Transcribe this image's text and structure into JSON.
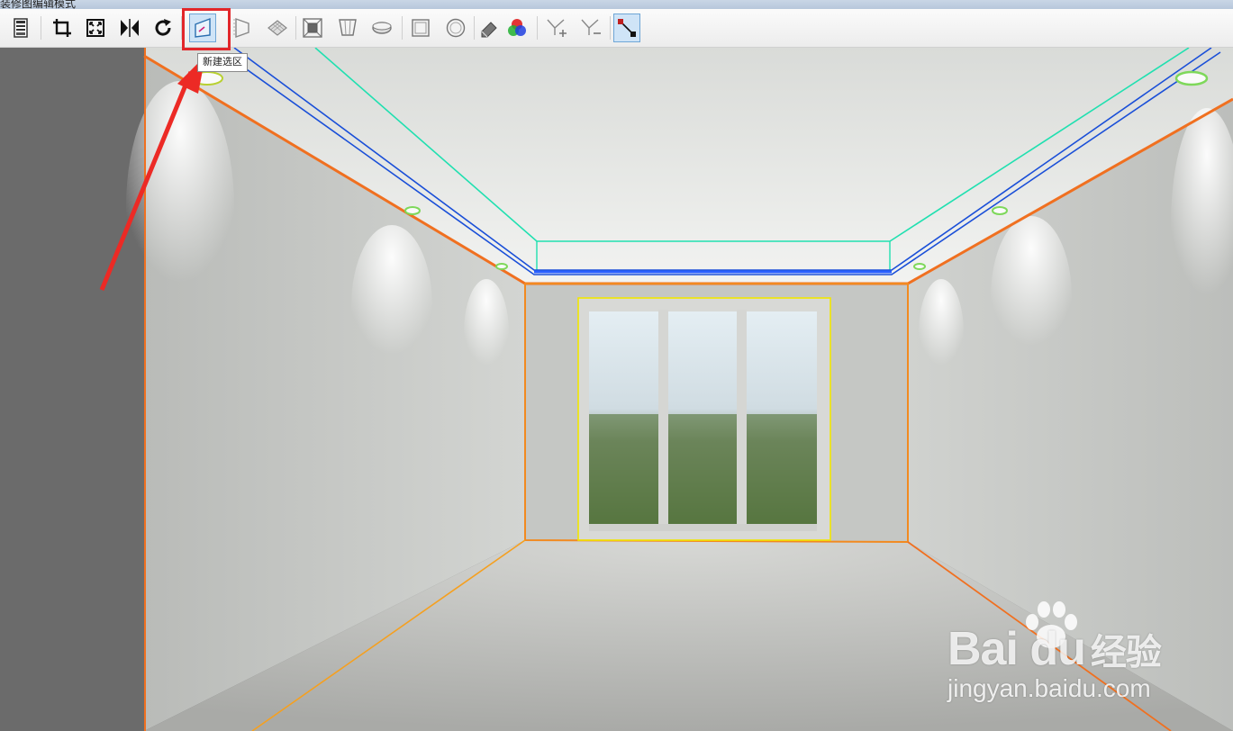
{
  "window": {
    "title": "装修图编辑模式"
  },
  "toolbar": {
    "buttons": [
      {
        "name": "save-button",
        "icon": "save-icon"
      },
      {
        "name": "crop-button",
        "icon": "crop-icon"
      },
      {
        "name": "fit-screen-button",
        "icon": "fit-screen-icon"
      },
      {
        "name": "mirror-button",
        "icon": "mirror-flip-icon"
      },
      {
        "name": "rotate-button",
        "icon": "refresh-icon"
      },
      {
        "name": "new-selection-button",
        "icon": "new-selection-icon",
        "active": true
      },
      {
        "name": "wall-side-button",
        "icon": "wall-side-icon"
      },
      {
        "name": "floor-grid-button",
        "icon": "floor-grid-icon"
      },
      {
        "name": "back-wall-button",
        "icon": "back-wall-icon"
      },
      {
        "name": "ceiling-button",
        "icon": "ceiling-panel-icon"
      },
      {
        "name": "ellipse-selection-button",
        "icon": "ellipse-icon"
      },
      {
        "name": "rect-selection-button",
        "icon": "rectangle-icon"
      },
      {
        "name": "circle-selection-button",
        "icon": "circle-icon"
      },
      {
        "name": "eraser-button",
        "icon": "eraser-icon"
      },
      {
        "name": "color-rgb-button",
        "icon": "rgb-color-icon"
      },
      {
        "name": "add-point-button",
        "icon": "add-point-icon"
      },
      {
        "name": "remove-point-button",
        "icon": "remove-point-icon"
      },
      {
        "name": "connect-points-button",
        "icon": "connect-points-icon"
      }
    ],
    "tooltip": "新建选区"
  },
  "colors": {
    "highlight": "#e2262a",
    "room_outline": "#f07020",
    "ceiling_inner": "#20e0b0",
    "ceiling_trim": "#1a4fd8",
    "window_frame": "#f2e600",
    "light_ring": "#7ed85a"
  },
  "watermark": {
    "brand": "Bai du",
    "brand_suffix": "经验",
    "url": "jingyan.baidu.com"
  }
}
